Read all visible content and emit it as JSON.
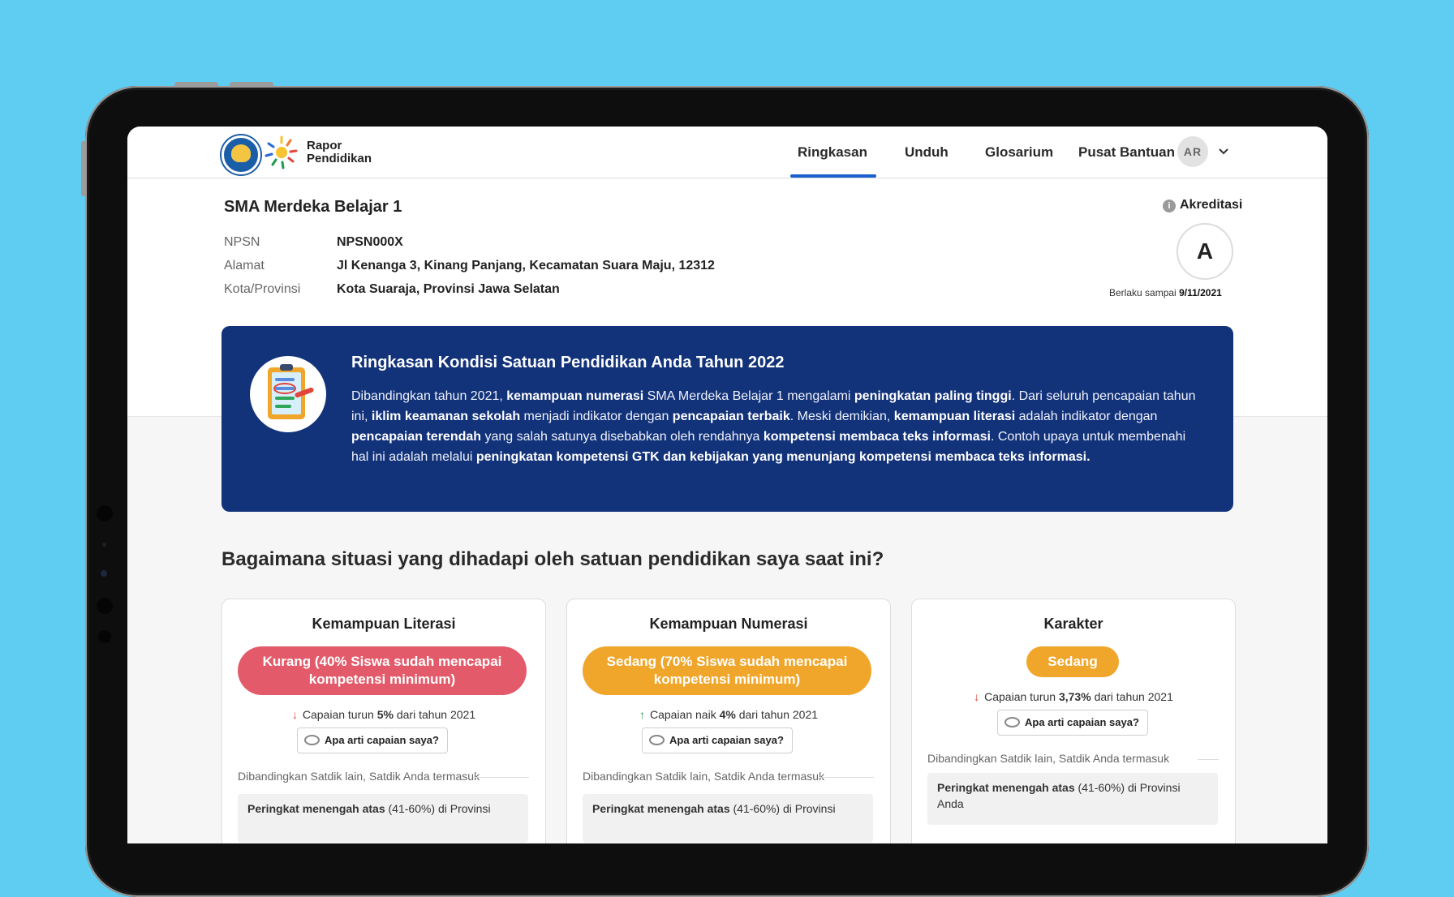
{
  "header": {
    "logo_text_line1": "Rapor",
    "logo_text_line2": "Pendidikan",
    "nav": [
      "Ringkasan",
      "Unduh",
      "Glosarium",
      "Pusat Bantuan"
    ],
    "active_nav": "Ringkasan",
    "avatar_initials": "AR"
  },
  "school": {
    "name": "SMA Merdeka Belajar 1",
    "rows": [
      {
        "label": "NPSN",
        "value": "NPSN000X"
      },
      {
        "label": "Alamat",
        "value": "Jl Kenanga 3, Kinang Panjang, Kecamatan Suara Maju, 12312"
      },
      {
        "label": "Kota/Provinsi",
        "value": "Kota Suaraja, Provinsi Jawa Selatan"
      }
    ],
    "accreditation_label": "Akreditasi",
    "accreditation_grade": "A",
    "valid_until_label": "Berlaku sampai",
    "valid_until_date": "9/11/2021"
  },
  "banner": {
    "title": "Ringkasan Kondisi Satuan Pendidikan Anda Tahun 2022"
  },
  "section_question": "Bagaimana situasi yang dihadapi oleh satuan pendidikan saya saat ini?",
  "cards": [
    {
      "title": "Kemampuan Literasi",
      "status": "Kurang (40% Siswa sudah mencapai kompetensi minimum)",
      "status_color": "#e35b6a",
      "change_prefix": "Capaian turun",
      "change_value": "5%",
      "change_suffix": "dari tahun 2021",
      "change_direction": "down",
      "ask_label": "Apa arti capaian saya?",
      "compare_label": "Dibandingkan Satdik lain, Satdik Anda termasuk",
      "rank_bold": "Peringkat menengah atas",
      "rank_rest": "(41-60%) di Provinsi"
    },
    {
      "title": "Kemampuan Numerasi",
      "status": "Sedang (70% Siswa sudah mencapai kompetensi minimum)",
      "status_color": "#f0a62a",
      "change_prefix": "Capaian naik",
      "change_value": "4%",
      "change_suffix": "dari tahun 2021",
      "change_direction": "up",
      "ask_label": "Apa arti capaian saya?",
      "compare_label": "Dibandingkan Satdik lain, Satdik Anda termasuk",
      "rank_bold": "Peringkat menengah atas",
      "rank_rest": "(41-60%) di Provinsi"
    },
    {
      "title": "Karakter",
      "status": "Sedang",
      "status_color": "#f0a62a",
      "change_prefix": "Capaian turun",
      "change_value": "3,73%",
      "change_suffix": "dari tahun 2021",
      "change_direction": "down",
      "ask_label": "Apa arti capaian saya?",
      "compare_label": "Dibandingkan Satdik lain, Satdik Anda termasuk",
      "rank_bold": "Peringkat menengah atas",
      "rank_rest": "(41-60%) di Provinsi Anda"
    }
  ],
  "colors": {
    "background": "#5fcdf2",
    "banner": "#12327a",
    "nav_active": "#1a5fd0",
    "down_arrow": "#e0443d",
    "up_arrow": "#2e9e4a"
  }
}
